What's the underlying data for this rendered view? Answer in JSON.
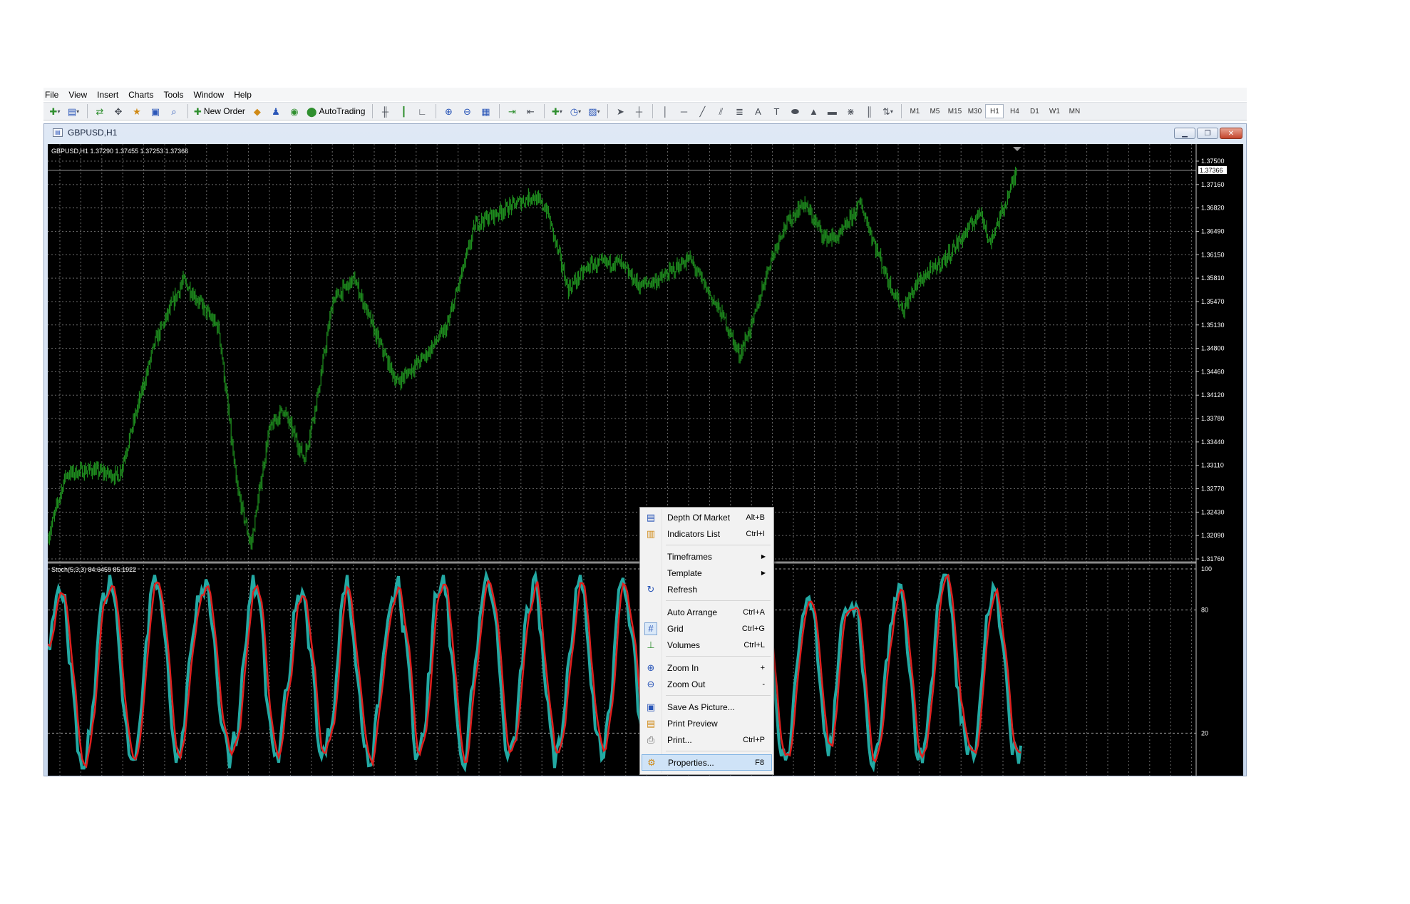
{
  "menubar": {
    "items": [
      "File",
      "View",
      "Insert",
      "Charts",
      "Tools",
      "Window",
      "Help"
    ]
  },
  "toolbar": {
    "new_order_label": "New Order",
    "autotrading_label": "AutoTrading",
    "timeframes": [
      "M1",
      "M5",
      "M15",
      "M30",
      "H1",
      "H4",
      "D1",
      "W1",
      "MN"
    ],
    "active_timeframe": "H1"
  },
  "chart_window": {
    "title": "GBPUSD,H1",
    "header": "GBPUSD,H1  1.37290 1.37455 1.37253 1.37366",
    "current_price": "1.37366",
    "price_axis": [
      "1.37500",
      "1.37160",
      "1.36820",
      "1.36490",
      "1.36150",
      "1.35810",
      "1.35470",
      "1.35130",
      "1.34800",
      "1.34460",
      "1.34120",
      "1.33780",
      "1.33440",
      "1.33110",
      "1.32770",
      "1.32430",
      "1.32090",
      "1.31760"
    ],
    "indicator_header": "Stoch(5,3,3) 84.6459 85.1922",
    "indicator_axis": [
      "100",
      "80",
      "20"
    ]
  },
  "context_menu": {
    "items": [
      {
        "label": "Depth Of Market",
        "shortcut": "Alt+B",
        "icon": "depth-of-market-icon"
      },
      {
        "label": "Indicators List",
        "shortcut": "Ctrl+I",
        "icon": "indicators-list-icon"
      },
      {
        "label": "Timeframes",
        "submenu": true
      },
      {
        "label": "Template",
        "submenu": true
      },
      {
        "label": "Refresh",
        "icon": "refresh-icon"
      },
      {
        "label": "Auto Arrange",
        "shortcut": "Ctrl+A"
      },
      {
        "label": "Grid",
        "shortcut": "Ctrl+G",
        "icon": "grid-icon"
      },
      {
        "label": "Volumes",
        "shortcut": "Ctrl+L",
        "icon": "volumes-icon"
      },
      {
        "label": "Zoom In",
        "shortcut": "+",
        "icon": "zoom-in-icon"
      },
      {
        "label": "Zoom Out",
        "shortcut": "-",
        "icon": "zoom-out-icon"
      },
      {
        "label": "Save As Picture...",
        "icon": "save-picture-icon"
      },
      {
        "label": "Print Preview",
        "icon": "print-preview-icon"
      },
      {
        "label": "Print...",
        "shortcut": "Ctrl+P",
        "icon": "print-icon"
      },
      {
        "label": "Properties...",
        "shortcut": "F8",
        "icon": "properties-icon",
        "highlighted": true
      }
    ]
  },
  "colors": {
    "chart_background": "#000000",
    "price_line": "#1e8c1e",
    "stoch_main": "#23a9a3",
    "stoch_signal": "#e0201e",
    "grid": "#6b6b6b"
  }
}
